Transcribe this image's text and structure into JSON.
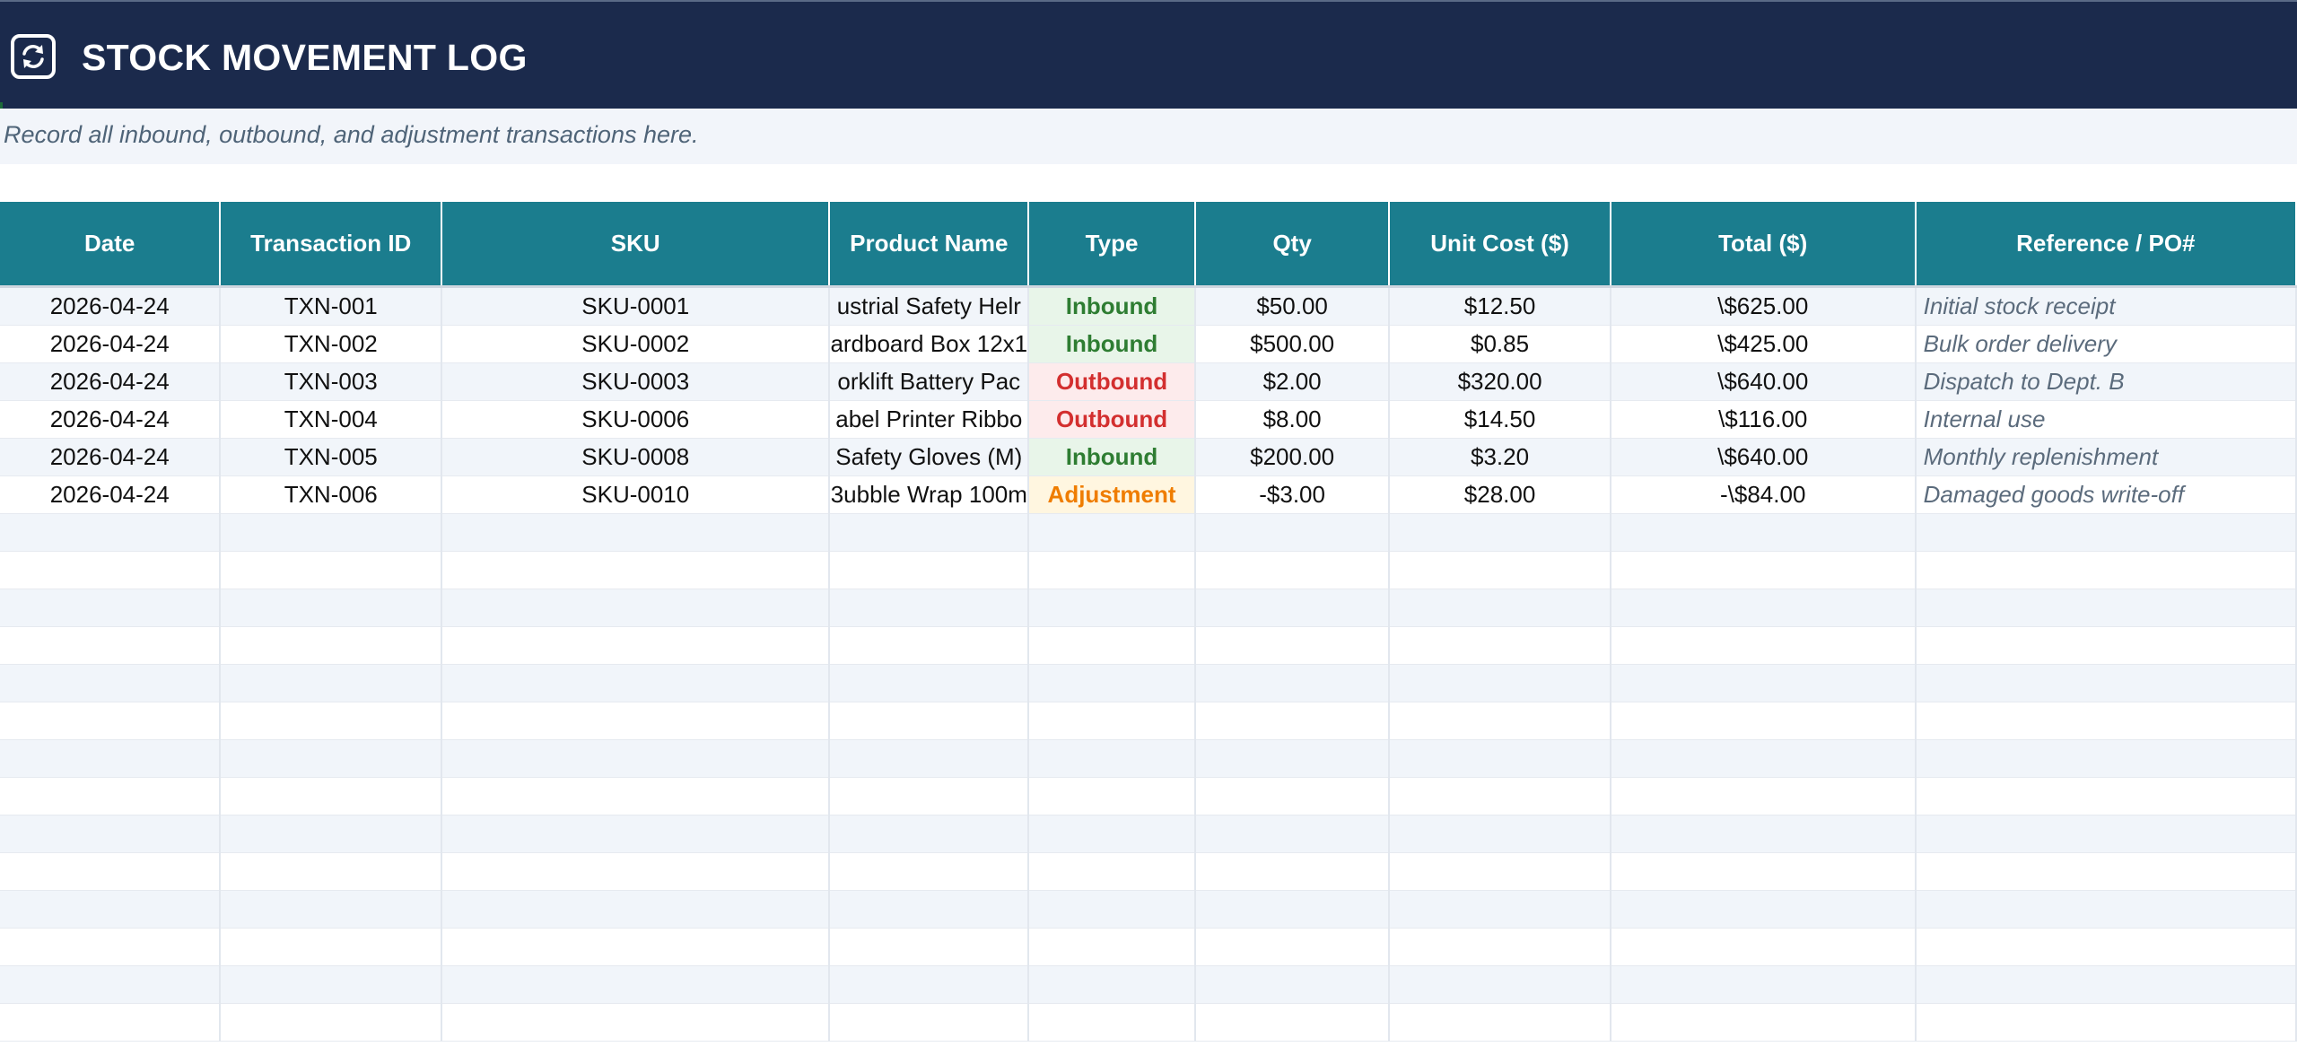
{
  "header": {
    "title": "STOCK MOVEMENT LOG",
    "icon": "refresh-icon",
    "subtitle": "Record all inbound, outbound, and adjustment transactions here."
  },
  "colors": {
    "title_bar": "#1b2a4c",
    "header_row": "#1b7d8e",
    "inbound": "#2e7d32",
    "outbound": "#d32f2f",
    "adjustment": "#ef7d00"
  },
  "table": {
    "columns": [
      "Date",
      "Transaction ID",
      "SKU",
      "Product Name",
      "Type",
      "Qty",
      "Unit Cost ($)",
      "Total ($)",
      "Reference / PO#"
    ],
    "rows": [
      {
        "date": "2026-04-24",
        "txn": "TXN-001",
        "sku": "SKU-0001",
        "product": "ustrial Safety Helr",
        "type": "Inbound",
        "qty": "$50.00",
        "unit_cost": "$12.50",
        "total": "\\$625.00",
        "ref": "Initial stock receipt"
      },
      {
        "date": "2026-04-24",
        "txn": "TXN-002",
        "sku": "SKU-0002",
        "product": "ardboard Box 12x1",
        "type": "Inbound",
        "qty": "$500.00",
        "unit_cost": "$0.85",
        "total": "\\$425.00",
        "ref": "Bulk order delivery"
      },
      {
        "date": "2026-04-24",
        "txn": "TXN-003",
        "sku": "SKU-0003",
        "product": "orklift Battery Pac",
        "type": "Outbound",
        "qty": "$2.00",
        "unit_cost": "$320.00",
        "total": "\\$640.00",
        "ref": "Dispatch to Dept. B"
      },
      {
        "date": "2026-04-24",
        "txn": "TXN-004",
        "sku": "SKU-0006",
        "product": "abel Printer Ribbo",
        "type": "Outbound",
        "qty": "$8.00",
        "unit_cost": "$14.50",
        "total": "\\$116.00",
        "ref": "Internal use"
      },
      {
        "date": "2026-04-24",
        "txn": "TXN-005",
        "sku": "SKU-0008",
        "product": "Safety Gloves (M)",
        "type": "Inbound",
        "qty": "$200.00",
        "unit_cost": "$3.20",
        "total": "\\$640.00",
        "ref": "Monthly replenishment"
      },
      {
        "date": "2026-04-24",
        "txn": "TXN-006",
        "sku": "SKU-0010",
        "product": "3ubble Wrap 100m",
        "type": "Adjustment",
        "qty": "-$3.00",
        "unit_cost": "$28.00",
        "total": "-\\$84.00",
        "ref": "Damaged goods write-off"
      }
    ]
  }
}
